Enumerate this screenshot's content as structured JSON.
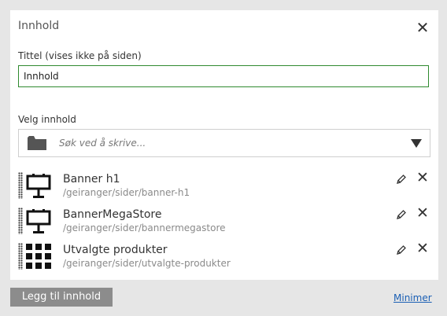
{
  "panel": {
    "title": "Innhold",
    "close_icon": "close-icon"
  },
  "title_field": {
    "label": "Tittel (vises ikke på siden)",
    "value": "Innhold"
  },
  "content_picker": {
    "label": "Velg innhold",
    "placeholder": "Søk ved å skrive...",
    "icon": "folder-icon"
  },
  "items": [
    {
      "title": "Banner h1",
      "path": "/geiranger/sider/banner-h1",
      "icon": "billboard-icon"
    },
    {
      "title": "BannerMegaStore",
      "path": "/geiranger/sider/bannermegastore",
      "icon": "billboard-icon"
    },
    {
      "title": "Utvalgte produkter",
      "path": "/geiranger/sider/utvalgte-produkter",
      "icon": "grid-icon"
    }
  ],
  "footer": {
    "add_label": "Legg til innhold",
    "minimize_label": "Minimer"
  },
  "colors": {
    "input_border": "#2f8a2f",
    "button_bg": "#8c8c8c",
    "link": "#1a5fb4"
  }
}
